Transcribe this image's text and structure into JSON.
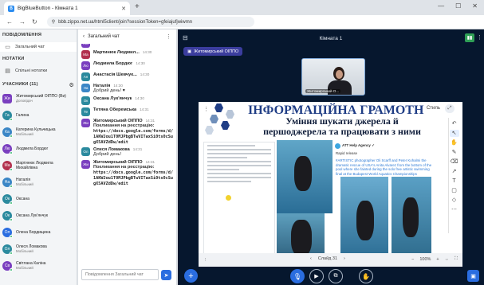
{
  "browser": {
    "tab_title": "BigBlueButton - Кімната 1",
    "tab_favicon": "B",
    "url": "bbb.zippo.net.ua/html5client/join?sessionToken=gfeiajufjwiwmn"
  },
  "sidebar": {
    "messages_header": "ПОВІДОМЛЕННЯ",
    "public_chat": "Загальний чат",
    "notes_header": "НОТАТКИ",
    "shared_notes": "Спільні нотатки",
    "users_header": "УЧАСНИКИ (11)",
    "users": [
      {
        "initials": "Жи",
        "name": "Житомирський ОІППО (Ви)",
        "sub": "Доповідач",
        "color": "#7a3fbf",
        "circle": false
      },
      {
        "initials": "Га",
        "name": "Галина",
        "sub": "",
        "color": "#2b8a9e",
        "circle": true
      },
      {
        "initials": "Ка",
        "name": "Катерина Кульчицька",
        "sub": "Мобільний",
        "color": "#3b86c6",
        "circle": true
      },
      {
        "initials": "Лю",
        "name": "Людмила Бордюг",
        "sub": "",
        "color": "#7a3fbf",
        "circle": true
      },
      {
        "initials": "Ма",
        "name": "Мартинюк Людмила Михайлівна",
        "sub": "",
        "color": "#b2314e",
        "circle": true
      },
      {
        "initials": "На",
        "name": "Наталія",
        "sub": "Мобільний",
        "color": "#3b86c6",
        "circle": true
      },
      {
        "initials": "Ок",
        "name": "Оксана",
        "sub": "",
        "color": "#2b8a9e",
        "circle": true
      },
      {
        "initials": "Ок",
        "name": "Оксана Лук'янчук",
        "sub": "",
        "color": "#2b8a9e",
        "circle": true
      },
      {
        "initials": "Ол",
        "name": "Олена Бордищина",
        "sub": "",
        "color": "#2a6de0",
        "circle": true
      },
      {
        "initials": "Ол",
        "name": "Олеся Ломакова",
        "sub": "Мобільний",
        "color": "#2b8a9e",
        "circle": true
      },
      {
        "initials": "Св",
        "name": "Світлана Каліна",
        "sub": "Мобільний",
        "color": "#7a3fbf",
        "circle": true
      }
    ]
  },
  "chat": {
    "title": "Загальний чат",
    "input_placeholder": "Повідомлення Загальний чат",
    "messages": [
      {
        "initials": "Жи",
        "color": "#7a3fbf",
        "name": "",
        "time": "",
        "text": "",
        "link": false,
        "bold": false,
        "partial": true
      },
      {
        "initials": "Ма",
        "color": "#b2314e",
        "name": "Мартинюк Людмил...",
        "time": "14:30",
        "text": "",
        "link": false,
        "bold": false
      },
      {
        "initials": "Лю",
        "color": "#7a3fbf",
        "name": "Людмила Бордюг",
        "time": "14:30",
        "text": "",
        "link": false,
        "bold": false
      },
      {
        "initials": "Ан",
        "color": "#2b8a9e",
        "name": "Анастасія Шевчук...",
        "time": "14:30",
        "text": "",
        "link": false,
        "bold": false
      },
      {
        "initials": "На",
        "color": "#3b86c6",
        "name": "Наталія",
        "time": "14:30",
        "text": "Добрий день! ♥",
        "link": false,
        "bold": false
      },
      {
        "initials": "Ок",
        "color": "#2b8a9e",
        "name": "Оксана Лук'янчук",
        "time": "14:30",
        "text": "",
        "link": false,
        "bold": false
      },
      {
        "initials": "Те",
        "color": "#2b8a9e",
        "name": "Тетяна Оберемська",
        "time": "14:31",
        "text": "",
        "link": false,
        "bold": false
      },
      {
        "initials": "Жи",
        "color": "#7a3fbf",
        "name": "Житомирський ОІППО",
        "time": "14:31",
        "text": "Покликання на реєстрацію:",
        "link": false,
        "bold": true,
        "link_text": "https://docs.google.com/forms/d/1AKWJou1T0MJPbgBTwVITaxSi0ts0cSugX5AVZdDw/edit"
      },
      {
        "initials": "Ол",
        "color": "#2b8a9e",
        "name": "Олеся Ломакова",
        "time": "14:31",
        "text": "Добрий день!",
        "link": false,
        "bold": false
      },
      {
        "initials": "Жи",
        "color": "#7a3fbf",
        "name": "Житомирський ОІППО",
        "time": "14:31",
        "text": "Покликання на реєстрацію:",
        "link": false,
        "bold": true,
        "link_text": "https://docs.google.com/forms/d/1AKWJou1T0MJPbgBTwVITaxSi0ts0cSugX5AVZdDw/edit"
      }
    ]
  },
  "main": {
    "room_title": "Кімната 1",
    "room_badge": "Житомирський ОІППО",
    "webcam_label": "Житомирський О...",
    "slide_title": "ІНФОРМАЦІЙНА ГРАМОТН",
    "slide_subtitle": "Уміння шукати джерела й першоджерела та працювати з ними",
    "style_label": "Стиль",
    "tweet_name": "ATT Help Agency ✓",
    "tweet_text": "Rapid release",
    "tweet_body": "#ARTISTIC photographer Oli Scarff and Peter Kohalmi the dramatic rescue of USA's Anita Alvarez from the bottom of the pool where she fainted during the solo free artistic swimming final at the Budapest World Aquatics Championships",
    "slide_nav_label": "Слайд 31",
    "zoom_label": "100%"
  }
}
